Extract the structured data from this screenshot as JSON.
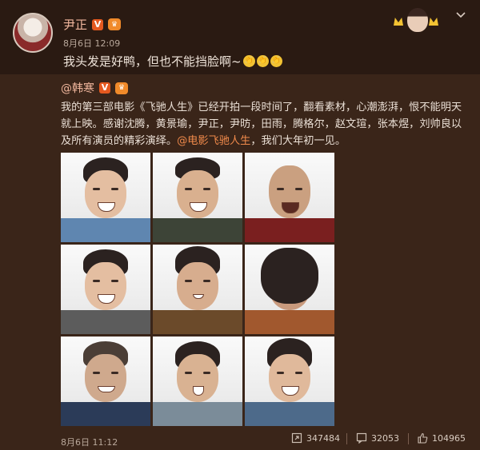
{
  "post": {
    "author": "尹正",
    "time": "8月6日 12:09",
    "text": "我头发是好鸭，但也不能挡脸啊~",
    "emoji": [
      "👏",
      "👏",
      "👏"
    ]
  },
  "retweet": {
    "author": "@韩寒",
    "text_before_link": "我的第三部电影《飞驰人生》已经开拍一段时间了，翻看素材，心潮澎湃，恨不能明天就上映。感谢沈腾，黄景瑜，尹正，尹昉，田雨，腾格尔，赵文瑄，张本煜，刘帅良以及所有演员的精彩演绎。",
    "link": "@电影飞驰人生",
    "text_after_link": "，我们大年初一见。",
    "time": "8月6日 11:12",
    "reposts": "347484",
    "comments": "32053",
    "likes": "104965"
  },
  "colors": {
    "background": "#2a1a12",
    "retweet_background": "#3a2519",
    "name": "#f1b79d",
    "link": "#f08a4b",
    "badge": "#e5591f"
  },
  "icons": [
    "verified-v-icon",
    "vip-crown-icon",
    "chevron-down-icon",
    "repost-icon",
    "comment-icon",
    "like-icon"
  ]
}
